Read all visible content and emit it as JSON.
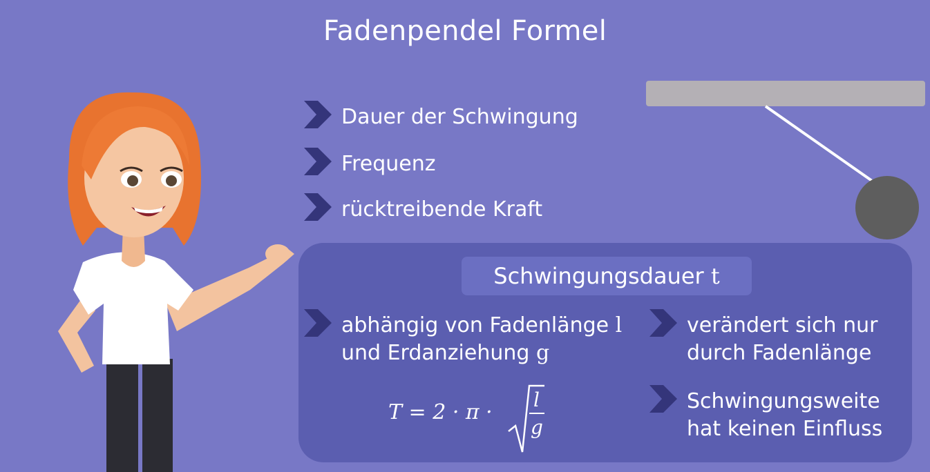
{
  "title": "Fadenpendel Formel",
  "bullets": [
    {
      "label": "Dauer der Schwingung"
    },
    {
      "label": "Frequenz"
    },
    {
      "label": "rücktreibende Kraft"
    }
  ],
  "panel": {
    "subtitle": "Schwingungsdauer",
    "subtitle_var": "t",
    "left_line1": "abhängig von Fadenlänge",
    "left_var1": "l",
    "left_line2": "und Erdanziehung",
    "left_var2": "g",
    "right1_line1": "verändert sich nur",
    "right1_line2": "durch Fadenlänge",
    "right2_line1": "Schwingungsweite",
    "right2_line2": "hat keinen Einfluss"
  },
  "formula": {
    "lhs": "T = 2 · π ·",
    "numerator": "l",
    "denominator": "g"
  },
  "colors": {
    "background": "#7878c6",
    "panel": "#5b5eb0",
    "chevron": "#34357a",
    "bar": "#b4b0b5",
    "bob": "#5e5e5e"
  },
  "icons": {
    "bullet": "chevron-right-icon"
  }
}
